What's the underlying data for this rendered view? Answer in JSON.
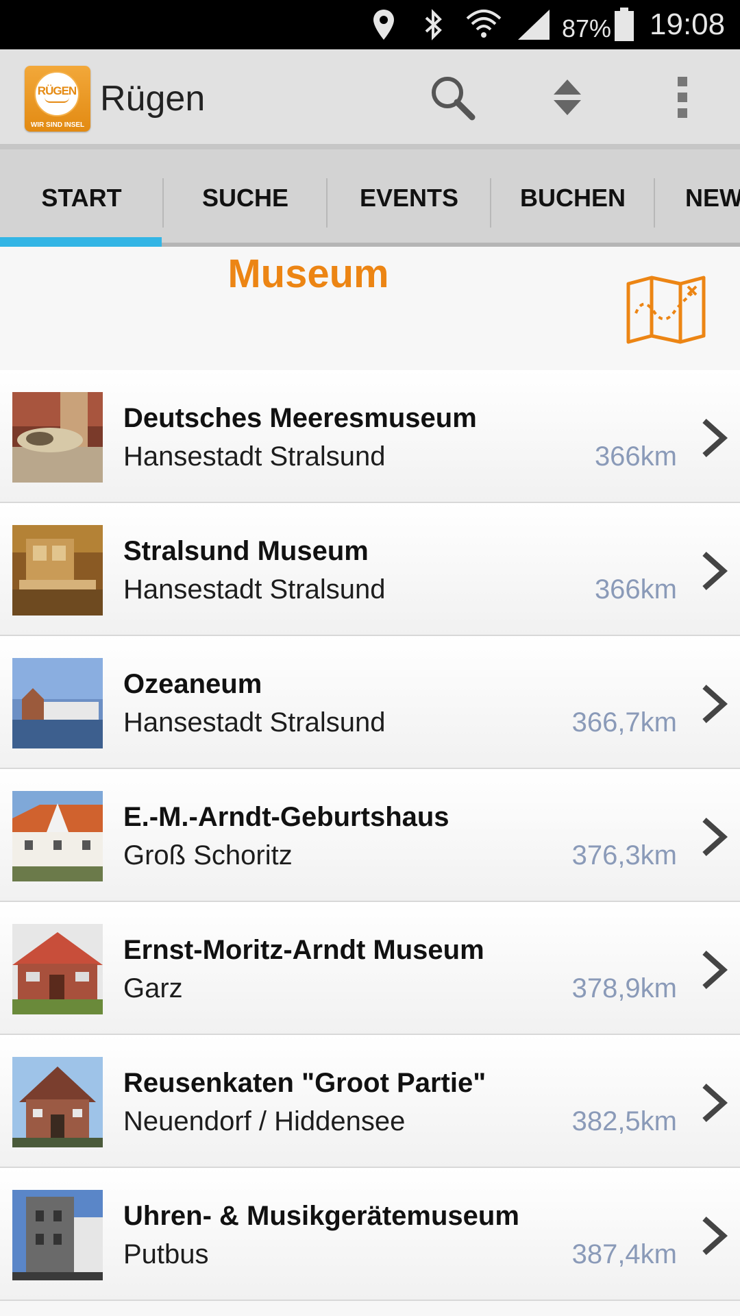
{
  "status_bar": {
    "battery_percent": "87%",
    "time": "19:08",
    "icons": [
      "location-icon",
      "bluetooth-icon",
      "wifi-icon",
      "signal-icon",
      "battery-icon"
    ]
  },
  "app_bar": {
    "logo_title": "RÜGEN",
    "logo_subtitle": "WIR SIND INSEL",
    "title": "Rügen",
    "actions": [
      "search-icon",
      "sort-icon",
      "overflow-menu-icon"
    ]
  },
  "tabs": [
    {
      "label": "START",
      "selected": true
    },
    {
      "label": "SUCHE",
      "selected": false
    },
    {
      "label": "EVENTS",
      "selected": false
    },
    {
      "label": "BUCHEN",
      "selected": false
    },
    {
      "label": "NEW",
      "selected": false
    }
  ],
  "section": {
    "title": "Museum",
    "map_icon": "map-icon"
  },
  "accent_colors": {
    "orange": "#ec8514",
    "tab_indicator": "#33b5e5",
    "distance": "#8a9ab8"
  },
  "items": [
    {
      "name": "Deutsches Meeresmuseum",
      "place": "Hansestadt Stralsund",
      "distance": "366km"
    },
    {
      "name": "Stralsund Museum",
      "place": "Hansestadt Stralsund",
      "distance": "366km"
    },
    {
      "name": "Ozeaneum",
      "place": "Hansestadt Stralsund",
      "distance": "366,7km"
    },
    {
      "name": "E.-M.-Arndt-Geburtshaus",
      "place": "Groß Schoritz",
      "distance": "376,3km"
    },
    {
      "name": "Ernst-Moritz-Arndt Museum",
      "place": "Garz",
      "distance": "378,9km"
    },
    {
      "name": "Reusenkaten \"Groot Partie\"",
      "place": "Neuendorf / Hiddensee",
      "distance": "382,5km"
    },
    {
      "name": "Uhren- & Musikgerätemuseum",
      "place": "Putbus",
      "distance": "387,4km"
    }
  ]
}
